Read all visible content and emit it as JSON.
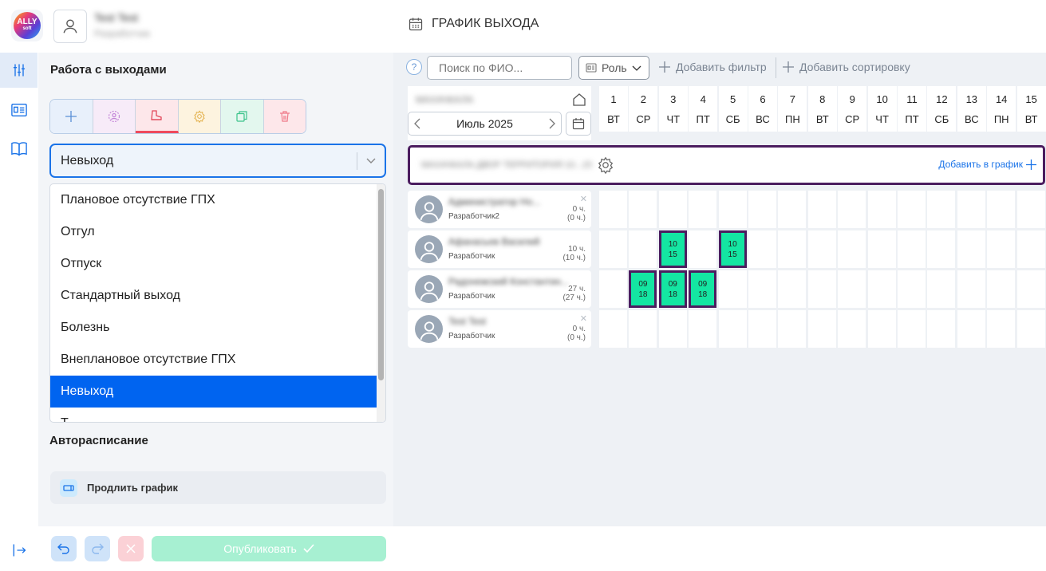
{
  "app": {
    "logo_text": "ALLY",
    "logo_sub": "soft",
    "user_name": "Test Test",
    "user_role": "Разработчик"
  },
  "header": {
    "title": "ГРАФИК ВЫХОДА"
  },
  "left_panel": {
    "section_title": "Работа с выходами",
    "toolbar_icons": [
      "plus-icon",
      "user-circle-icon",
      "boot-icon",
      "gear-icon",
      "copy-icon",
      "trash-icon"
    ],
    "select_value": "Невыход",
    "dropdown_options": [
      "Плановое отсутствие ГПХ",
      "Отгул",
      "Отпуск",
      "Стандартный выход",
      "Болезнь",
      "Внеплановое отсутствие ГПХ",
      "Невыход",
      "Т..."
    ],
    "dropdown_selected": "Невыход",
    "auto_title": "Авторасписание",
    "extend_label": "Продлить график"
  },
  "bottom": {
    "publish_label": "Опубликовать"
  },
  "filters": {
    "help": "?",
    "search_placeholder": "Поиск по ФИО...",
    "role_label": "Роль",
    "add_filter": "Добавить фильтр",
    "add_sort": "Добавить сортировку"
  },
  "calendar": {
    "location": "МАХАЧКАЛА",
    "month": "Июль 2025",
    "days": [
      {
        "n": "1",
        "d": "ВТ"
      },
      {
        "n": "2",
        "d": "СР"
      },
      {
        "n": "3",
        "d": "ЧТ"
      },
      {
        "n": "4",
        "d": "ПТ"
      },
      {
        "n": "5",
        "d": "СБ"
      },
      {
        "n": "6",
        "d": "ВС"
      },
      {
        "n": "7",
        "d": "ПН"
      },
      {
        "n": "8",
        "d": "ВТ"
      },
      {
        "n": "9",
        "d": "СР"
      },
      {
        "n": "10",
        "d": "ЧТ"
      },
      {
        "n": "11",
        "d": "ПТ"
      },
      {
        "n": "12",
        "d": "СБ"
      },
      {
        "n": "13",
        "d": "ВС"
      },
      {
        "n": "14",
        "d": "ПН"
      },
      {
        "n": "15",
        "d": "ВТ"
      }
    ],
    "department": "МАХАЧКАЛА ДВОР ТЕРРИТОРИЯ 10...15",
    "add_to_schedule": "Добавить в график"
  },
  "employees": [
    {
      "name": "Администратор Но...",
      "role": "Разработчик2",
      "hours": "0 ч.",
      "hours_sub": "(0 ч.)",
      "removable": true,
      "shifts": []
    },
    {
      "name": "Афанасьев Василий",
      "role": "Разработчик",
      "hours": "10 ч.",
      "hours_sub": "(10 ч.)",
      "removable": false,
      "shifts": [
        {
          "day": 3,
          "start": "10",
          "end": "15"
        },
        {
          "day": 5,
          "start": "10",
          "end": "15"
        }
      ]
    },
    {
      "name": "Радонежский Константин...",
      "role": "Разработчик",
      "hours": "27 ч.",
      "hours_sub": "(27 ч.)",
      "removable": false,
      "shifts": [
        {
          "day": 2,
          "start": "09",
          "end": "18"
        },
        {
          "day": 3,
          "start": "09",
          "end": "18"
        },
        {
          "day": 4,
          "start": "09",
          "end": "18"
        }
      ]
    },
    {
      "name": "Test Test",
      "role": "Разработчик",
      "hours": "0 ч.",
      "hours_sub": "(0 ч.)",
      "removable": true,
      "shifts": []
    }
  ]
}
